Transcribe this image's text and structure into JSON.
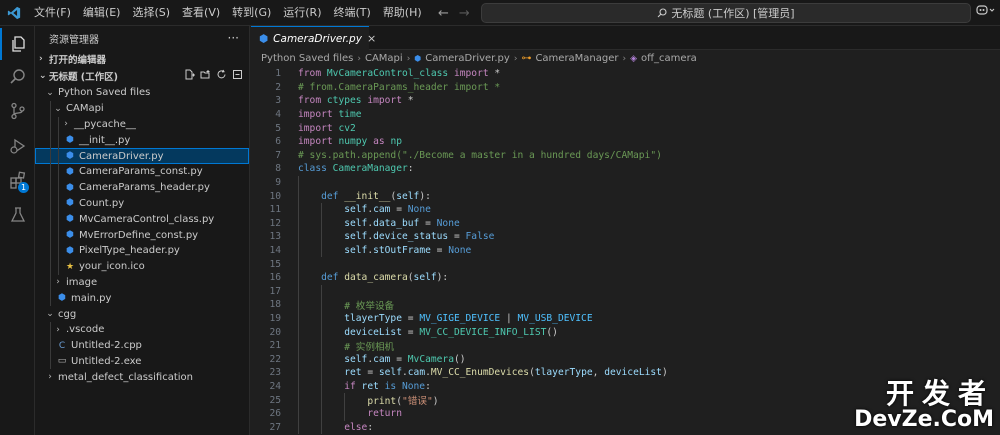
{
  "menu": [
    "文件(F)",
    "编辑(E)",
    "选择(S)",
    "查看(V)",
    "转到(G)",
    "运行(R)",
    "终端(T)",
    "帮助(H)"
  ],
  "search": {
    "text": "无标题 (工作区) [管理员]"
  },
  "activity": {
    "extensions_badge": "1"
  },
  "sidebar": {
    "title": "资源管理器",
    "more": "···",
    "open_editors": "打开的编辑器",
    "workspace": "无标题 (工作区)",
    "tree": [
      {
        "label": "Python Saved files",
        "depth": 0,
        "chev": "⌄",
        "icon": ""
      },
      {
        "label": "CAMapi",
        "depth": 1,
        "chev": "⌄",
        "icon": ""
      },
      {
        "label": "__pycache__",
        "depth": 2,
        "chev": "›",
        "icon": ""
      },
      {
        "label": "__init__.py",
        "depth": 2,
        "chev": "",
        "icon": "py"
      },
      {
        "label": "CameraDriver.py",
        "depth": 2,
        "chev": "",
        "icon": "py",
        "selected": true
      },
      {
        "label": "CameraParams_const.py",
        "depth": 2,
        "chev": "",
        "icon": "py"
      },
      {
        "label": "CameraParams_header.py",
        "depth": 2,
        "chev": "",
        "icon": "py"
      },
      {
        "label": "Count.py",
        "depth": 2,
        "chev": "",
        "icon": "py"
      },
      {
        "label": "MvCameraControl_class.py",
        "depth": 2,
        "chev": "",
        "icon": "py"
      },
      {
        "label": "MvErrorDefine_const.py",
        "depth": 2,
        "chev": "",
        "icon": "py"
      },
      {
        "label": "PixelType_header.py",
        "depth": 2,
        "chev": "",
        "icon": "py"
      },
      {
        "label": "your_icon.ico",
        "depth": 2,
        "chev": "",
        "icon": "ico"
      },
      {
        "label": "image",
        "depth": 1,
        "chev": "›",
        "icon": ""
      },
      {
        "label": "main.py",
        "depth": 1,
        "chev": "",
        "icon": "py"
      },
      {
        "label": "cgg",
        "depth": 0,
        "chev": "⌄",
        "icon": ""
      },
      {
        "label": ".vscode",
        "depth": 1,
        "chev": "›",
        "icon": ""
      },
      {
        "label": "Untitled-2.cpp",
        "depth": 1,
        "chev": "",
        "icon": "cpp"
      },
      {
        "label": "Untitled-2.exe",
        "depth": 1,
        "chev": "",
        "icon": "exe"
      },
      {
        "label": "metal_defect_classification",
        "depth": 0,
        "chev": "›",
        "icon": ""
      }
    ]
  },
  "editor": {
    "tab_label": "CameraDriver.py",
    "breadcrumb": [
      "Python Saved files",
      "CAMapi",
      "CameraDriver.py",
      "CameraManager",
      "off_camera"
    ],
    "lines": [
      [
        [
          "kw2",
          "from "
        ],
        [
          "mod",
          "MvCameraControl_class"
        ],
        [
          "kw2",
          " import "
        ],
        [
          "plain",
          "*"
        ]
      ],
      [
        [
          "cm",
          "# from.CameraParams_header import *"
        ]
      ],
      [
        [
          "kw2",
          "from "
        ],
        [
          "mod",
          "ctypes"
        ],
        [
          "kw2",
          " import "
        ],
        [
          "plain",
          "*"
        ]
      ],
      [
        [
          "kw2",
          "import "
        ],
        [
          "mod",
          "time"
        ]
      ],
      [
        [
          "kw2",
          "import "
        ],
        [
          "mod",
          "cv2"
        ]
      ],
      [
        [
          "kw2",
          "import "
        ],
        [
          "mod",
          "numpy"
        ],
        [
          "kw2",
          " as "
        ],
        [
          "mod",
          "np"
        ]
      ],
      [
        [
          "cm",
          "# sys.path.append(\"./Become a master in a hundred days/CAMapi\")"
        ]
      ],
      [
        [
          "kw",
          "class "
        ],
        [
          "cls",
          "CameraManager"
        ],
        [
          "plain",
          ":"
        ]
      ],
      [],
      [
        [
          "plain",
          "    "
        ],
        [
          "kw",
          "def "
        ],
        [
          "fn",
          "__init__"
        ],
        [
          "plain",
          "("
        ],
        [
          "var",
          "self"
        ],
        [
          "plain",
          "):"
        ]
      ],
      [
        [
          "plain",
          "        "
        ],
        [
          "var",
          "self"
        ],
        [
          "plain",
          "."
        ],
        [
          "var",
          "cam"
        ],
        [
          "plain",
          " = "
        ],
        [
          "kw",
          "None"
        ]
      ],
      [
        [
          "plain",
          "        "
        ],
        [
          "var",
          "self"
        ],
        [
          "plain",
          "."
        ],
        [
          "var",
          "data_buf"
        ],
        [
          "plain",
          " = "
        ],
        [
          "kw",
          "None"
        ]
      ],
      [
        [
          "plain",
          "        "
        ],
        [
          "var",
          "self"
        ],
        [
          "plain",
          "."
        ],
        [
          "var",
          "device_status"
        ],
        [
          "plain",
          " = "
        ],
        [
          "kw",
          "False"
        ]
      ],
      [
        [
          "plain",
          "        "
        ],
        [
          "var",
          "self"
        ],
        [
          "plain",
          "."
        ],
        [
          "var",
          "stOutFrame"
        ],
        [
          "plain",
          " = "
        ],
        [
          "kw",
          "None"
        ]
      ],
      [],
      [
        [
          "plain",
          "    "
        ],
        [
          "kw",
          "def "
        ],
        [
          "fn",
          "data_camera"
        ],
        [
          "plain",
          "("
        ],
        [
          "var",
          "self"
        ],
        [
          "plain",
          "):"
        ]
      ],
      [],
      [
        [
          "plain",
          "        "
        ],
        [
          "cm",
          "# 枚举设备"
        ]
      ],
      [
        [
          "plain",
          "        "
        ],
        [
          "var",
          "tlayerType"
        ],
        [
          "plain",
          " = "
        ],
        [
          "const",
          "MV_GIGE_DEVICE"
        ],
        [
          "plain",
          " | "
        ],
        [
          "const",
          "MV_USB_DEVICE"
        ]
      ],
      [
        [
          "plain",
          "        "
        ],
        [
          "var",
          "deviceList"
        ],
        [
          "plain",
          " = "
        ],
        [
          "cls",
          "MV_CC_DEVICE_INFO_LIST"
        ],
        [
          "plain",
          "()"
        ]
      ],
      [
        [
          "plain",
          "        "
        ],
        [
          "cm",
          "# 实例相机"
        ]
      ],
      [
        [
          "plain",
          "        "
        ],
        [
          "var",
          "self"
        ],
        [
          "plain",
          "."
        ],
        [
          "var",
          "cam"
        ],
        [
          "plain",
          " = "
        ],
        [
          "cls",
          "MvCamera"
        ],
        [
          "plain",
          "()"
        ]
      ],
      [
        [
          "plain",
          "        "
        ],
        [
          "var",
          "ret"
        ],
        [
          "plain",
          " = "
        ],
        [
          "var",
          "self"
        ],
        [
          "plain",
          "."
        ],
        [
          "var",
          "cam"
        ],
        [
          "plain",
          "."
        ],
        [
          "fn",
          "MV_CC_EnumDevices"
        ],
        [
          "plain",
          "("
        ],
        [
          "var",
          "tlayerType"
        ],
        [
          "plain",
          ", "
        ],
        [
          "var",
          "deviceList"
        ],
        [
          "plain",
          ")"
        ]
      ],
      [
        [
          "plain",
          "        "
        ],
        [
          "kw2",
          "if "
        ],
        [
          "var",
          "ret"
        ],
        [
          "kw",
          " is "
        ],
        [
          "kw",
          "None"
        ],
        [
          "plain",
          ":"
        ]
      ],
      [
        [
          "plain",
          "            "
        ],
        [
          "fn",
          "print"
        ],
        [
          "plain",
          "("
        ],
        [
          "str",
          "\"错误\""
        ],
        [
          "plain",
          ")"
        ]
      ],
      [
        [
          "plain",
          "            "
        ],
        [
          "kw2",
          "return"
        ]
      ],
      [
        [
          "plain",
          "        "
        ],
        [
          "kw2",
          "else"
        ],
        [
          "plain",
          ":"
        ]
      ]
    ]
  },
  "watermark": {
    "line1": "开发者",
    "line2": "DevZe.CoM"
  },
  "colors": {
    "kw": "#569cd6",
    "kw2": "#c586c0",
    "mod": "#4ec9b0",
    "cls": "#4ec9b0",
    "fn": "#dcdcaa",
    "var": "#9cdcfe",
    "const": "#4fc1ff",
    "str": "#ce9178",
    "cm": "#6a9955",
    "plain": "#cccccc",
    "accent": "#0078d4"
  }
}
